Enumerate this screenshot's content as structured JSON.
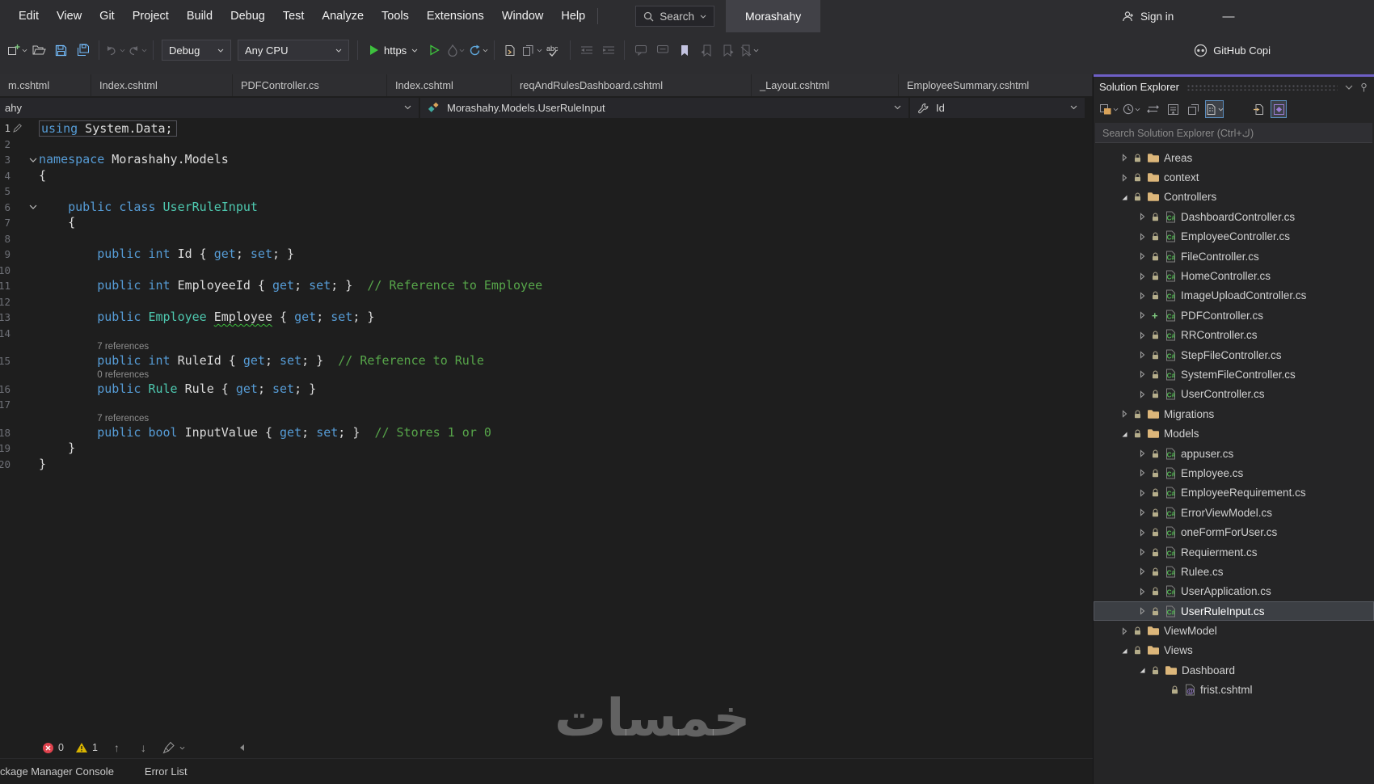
{
  "title_bar": {
    "menus": [
      "Edit",
      "View",
      "Git",
      "Project",
      "Build",
      "Debug",
      "Test",
      "Analyze",
      "Tools",
      "Extensions",
      "Window",
      "Help"
    ],
    "search_label": "Search",
    "solution_name": "Morashahy",
    "sign_in_label": "Sign in",
    "minimize_glyph": "—"
  },
  "toolbar": {
    "debug_target": "Debug",
    "platform": "Any CPU",
    "run_profile": "https",
    "spell_label": "abc",
    "copilot_label": "GitHub Copi"
  },
  "tab_bar": {
    "tabs": [
      {
        "label": "m.cshtml"
      },
      {
        "label": "Index.cshtml"
      },
      {
        "label": "PDFController.cs"
      },
      {
        "label": "Index.cshtml"
      },
      {
        "label": "reqAndRulesDashboard.cshtml"
      },
      {
        "label": "_Layout.cshtml"
      },
      {
        "label": "EmployeeSummary.cshtml"
      }
    ]
  },
  "breadcrumb": {
    "project": "ahy",
    "type": "Morashahy.Models.UserRuleInput",
    "member": "Id"
  },
  "editor": {
    "rows": [
      {
        "kind": "code",
        "num": "1",
        "current": true,
        "margin_icons": true,
        "tokens": [
          [
            "kw",
            "using"
          ],
          [
            "pl",
            " System.Data;"
          ]
        ]
      },
      {
        "kind": "code",
        "num": "2",
        "tokens": []
      },
      {
        "kind": "code",
        "num": "3",
        "fold": true,
        "tokens": [
          [
            "kw",
            "namespace"
          ],
          [
            "pl",
            " Morashahy.Models"
          ]
        ]
      },
      {
        "kind": "code",
        "num": "4",
        "tokens": [
          [
            "pl",
            "{"
          ]
        ]
      },
      {
        "kind": "code",
        "num": "5",
        "tokens": []
      },
      {
        "kind": "code",
        "num": "6",
        "fold": true,
        "tokens": [
          [
            "pl",
            "    "
          ],
          [
            "kw",
            "public"
          ],
          [
            "pl",
            " "
          ],
          [
            "kw",
            "class"
          ],
          [
            "pl",
            " "
          ],
          [
            "ty",
            "UserRuleInput"
          ]
        ]
      },
      {
        "kind": "code",
        "num": "7",
        "tokens": [
          [
            "pl",
            "    {"
          ]
        ]
      },
      {
        "kind": "code",
        "num": "8",
        "tokens": []
      },
      {
        "kind": "code",
        "num": "9",
        "tokens": [
          [
            "pl",
            "        "
          ],
          [
            "kw",
            "public"
          ],
          [
            "pl",
            " "
          ],
          [
            "kw",
            "int"
          ],
          [
            "pl",
            " Id { "
          ],
          [
            "kw",
            "get"
          ],
          [
            "pl",
            "; "
          ],
          [
            "kw",
            "set"
          ],
          [
            "pl",
            "; }"
          ]
        ]
      },
      {
        "kind": "code",
        "num": "10",
        "tokens": []
      },
      {
        "kind": "code",
        "num": "11",
        "tokens": [
          [
            "pl",
            "        "
          ],
          [
            "kw",
            "public"
          ],
          [
            "pl",
            " "
          ],
          [
            "kw",
            "int"
          ],
          [
            "pl",
            " EmployeeId { "
          ],
          [
            "kw",
            "get"
          ],
          [
            "pl",
            "; "
          ],
          [
            "kw",
            "set"
          ],
          [
            "pl",
            "; }  "
          ],
          [
            "cm",
            "// Reference to Employee"
          ]
        ]
      },
      {
        "kind": "code",
        "num": "12",
        "tokens": []
      },
      {
        "kind": "code",
        "num": "13",
        "tokens": [
          [
            "pl",
            "        "
          ],
          [
            "kw",
            "public"
          ],
          [
            "pl",
            " "
          ],
          [
            "ty",
            "Employee"
          ],
          [
            "pl",
            " "
          ],
          [
            "sq",
            "Employee"
          ],
          [
            "pl",
            " { "
          ],
          [
            "kw",
            "get"
          ],
          [
            "pl",
            "; "
          ],
          [
            "kw",
            "set"
          ],
          [
            "pl",
            "; }"
          ]
        ]
      },
      {
        "kind": "code",
        "num": "14",
        "tokens": []
      },
      {
        "kind": "lens",
        "indent": 8,
        "text": "7 references"
      },
      {
        "kind": "code",
        "num": "15",
        "tokens": [
          [
            "pl",
            "        "
          ],
          [
            "kw",
            "public"
          ],
          [
            "pl",
            " "
          ],
          [
            "kw",
            "int"
          ],
          [
            "pl",
            " RuleId { "
          ],
          [
            "kw",
            "get"
          ],
          [
            "pl",
            "; "
          ],
          [
            "kw",
            "set"
          ],
          [
            "pl",
            "; }  "
          ],
          [
            "cm",
            "// Reference to Rule"
          ]
        ]
      },
      {
        "kind": "lens",
        "indent": 8,
        "text": "0 references"
      },
      {
        "kind": "code",
        "num": "16",
        "tokens": [
          [
            "pl",
            "        "
          ],
          [
            "kw",
            "public"
          ],
          [
            "pl",
            " "
          ],
          [
            "ty",
            "Rule"
          ],
          [
            "pl",
            " Rule { "
          ],
          [
            "kw",
            "get"
          ],
          [
            "pl",
            "; "
          ],
          [
            "kw",
            "set"
          ],
          [
            "pl",
            "; }"
          ]
        ]
      },
      {
        "kind": "code",
        "num": "17",
        "tokens": []
      },
      {
        "kind": "lens",
        "indent": 8,
        "text": "7 references"
      },
      {
        "kind": "code",
        "num": "18",
        "tokens": [
          [
            "pl",
            "        "
          ],
          [
            "kw",
            "public"
          ],
          [
            "pl",
            " "
          ],
          [
            "kw",
            "bool"
          ],
          [
            "pl",
            " InputValue { "
          ],
          [
            "kw",
            "get"
          ],
          [
            "pl",
            "; "
          ],
          [
            "kw",
            "set"
          ],
          [
            "pl",
            "; }  "
          ],
          [
            "cm",
            "// Stores 1 or 0"
          ]
        ]
      },
      {
        "kind": "code",
        "num": "19",
        "tokens": [
          [
            "pl",
            "    }"
          ]
        ]
      },
      {
        "kind": "code",
        "num": "20",
        "tokens": [
          [
            "pl",
            "}"
          ]
        ]
      }
    ]
  },
  "health": {
    "errors": "0",
    "warnings": "1"
  },
  "bottom_panel": {
    "tabs": [
      "ckage Manager Console",
      "Error List"
    ]
  },
  "watermark": "خمسات",
  "solution_explorer": {
    "title": "Solution Explorer",
    "search_placeholder": "Search Solution Explorer (Ctrl+ك)",
    "items": [
      {
        "label": "Areas",
        "level": 2,
        "arrow": "collapsed",
        "icon": "folder",
        "badge": "lock"
      },
      {
        "label": "context",
        "level": 2,
        "arrow": "collapsed",
        "icon": "folder",
        "badge": "lock"
      },
      {
        "label": "Controllers",
        "level": 2,
        "arrow": "expanded",
        "icon": "folder",
        "badge": "lock"
      },
      {
        "label": "DashboardController.cs",
        "level": 3,
        "arrow": "collapsed",
        "icon": "cs",
        "badge": "lock"
      },
      {
        "label": "EmployeeController.cs",
        "level": 3,
        "arrow": "collapsed",
        "icon": "cs",
        "badge": "lock"
      },
      {
        "label": "FileController.cs",
        "level": 3,
        "arrow": "collapsed",
        "icon": "cs",
        "badge": "lock"
      },
      {
        "label": "HomeController.cs",
        "level": 3,
        "arrow": "collapsed",
        "icon": "cs",
        "badge": "lock"
      },
      {
        "label": "ImageUploadController.cs",
        "level": 3,
        "arrow": "collapsed",
        "icon": "cs",
        "badge": "lock"
      },
      {
        "label": "PDFController.cs",
        "level": 3,
        "arrow": "collapsed",
        "icon": "cs",
        "badge": "plus"
      },
      {
        "label": "RRController.cs",
        "level": 3,
        "arrow": "collapsed",
        "icon": "cs",
        "badge": "lock"
      },
      {
        "label": "StepFileController.cs",
        "level": 3,
        "arrow": "collapsed",
        "icon": "cs",
        "badge": "lock"
      },
      {
        "label": "SystemFileController.cs",
        "level": 3,
        "arrow": "collapsed",
        "icon": "cs",
        "badge": "lock"
      },
      {
        "label": "UserController.cs",
        "level": 3,
        "arrow": "collapsed",
        "icon": "cs",
        "badge": "lock"
      },
      {
        "label": "Migrations",
        "level": 2,
        "arrow": "collapsed",
        "icon": "folder",
        "badge": "lock"
      },
      {
        "label": "Models",
        "level": 2,
        "arrow": "expanded",
        "icon": "folder",
        "badge": "lock"
      },
      {
        "label": "appuser.cs",
        "level": 3,
        "arrow": "collapsed",
        "icon": "cs",
        "badge": "lock"
      },
      {
        "label": "Employee.cs",
        "level": 3,
        "arrow": "collapsed",
        "icon": "cs",
        "badge": "lock"
      },
      {
        "label": "EmployeeRequirement.cs",
        "level": 3,
        "arrow": "collapsed",
        "icon": "cs",
        "badge": "lock"
      },
      {
        "label": "ErrorViewModel.cs",
        "level": 3,
        "arrow": "collapsed",
        "icon": "cs",
        "badge": "lock"
      },
      {
        "label": "oneFormForUser.cs",
        "level": 3,
        "arrow": "collapsed",
        "icon": "cs",
        "badge": "lock"
      },
      {
        "label": "Requierment.cs",
        "level": 3,
        "arrow": "collapsed",
        "icon": "cs",
        "badge": "lock"
      },
      {
        "label": "Rulee.cs",
        "level": 3,
        "arrow": "collapsed",
        "icon": "cs",
        "badge": "lock"
      },
      {
        "label": "UserApplication.cs",
        "level": 3,
        "arrow": "collapsed",
        "icon": "cs",
        "badge": "lock"
      },
      {
        "label": "UserRuleInput.cs",
        "level": 3,
        "arrow": "collapsed",
        "icon": "cs",
        "badge": "lock",
        "selected": true
      },
      {
        "label": "ViewModel",
        "level": 2,
        "arrow": "collapsed",
        "icon": "folder",
        "badge": "lock"
      },
      {
        "label": "Views",
        "level": 2,
        "arrow": "expanded",
        "icon": "folder",
        "badge": "lock"
      },
      {
        "label": "Dashboard",
        "level": 3,
        "arrow": "expanded",
        "icon": "folder",
        "badge": "lock"
      },
      {
        "label": "frist.cshtml",
        "level": 4,
        "arrow": "none",
        "icon": "razor",
        "badge": "lock"
      }
    ]
  },
  "icons": {
    "title_search": "search-icon",
    "sign_in": "person-icon",
    "run": "play-icon",
    "restart": "restart-icon",
    "hot_reload": "flame-icon",
    "errors": "error-circle-icon",
    "warnings": "warning-triangle-icon",
    "member": "wrench-icon",
    "type": "class-cube-icon"
  },
  "colors": {
    "keyword": "#569cd6",
    "type": "#4ec9b0",
    "comment": "#57a64a",
    "folder": "#dcb67a",
    "panel_accent": "#6e5fc6",
    "selection_bg": "#3c3f44",
    "error": "#e0434e",
    "warning": "#d9b400",
    "run_green": "#3ec13e"
  }
}
